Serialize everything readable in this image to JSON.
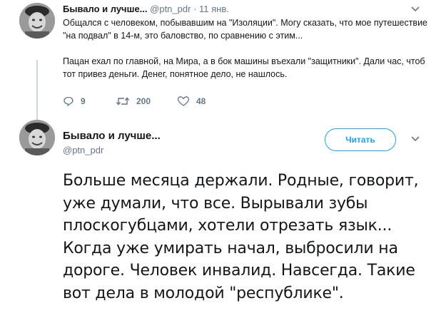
{
  "tweet1": {
    "name": "Бывало и лучше...",
    "handle": "@ptn_pdr",
    "separator": "·",
    "time": "11 янв.",
    "paragraph1": "Общался с человеком, побывавшим на \"Изоляции\". Могу сказать, что мое путешествие \"на подвал\" в 14-м, это баловство, по сравнению с этим...",
    "paragraph2": "Пацан ехал по главной, на Мира, а в бок машины въехали \"защитники\". Дали час, чтоб тот привез деньги. Денег, понятное дело, не нашлось.",
    "replies": "9",
    "retweets": "200",
    "likes": "48",
    "icons": [
      "reply-icon",
      "retweet-icon",
      "like-icon",
      "chevron-down-icon"
    ]
  },
  "tweet2": {
    "name": "Бывало и лучше...",
    "handle": "@ptn_pdr",
    "follow_label": "Читать",
    "text": "Больше месяца держали. Родные, говорит, уже думали, что все. Вырывали зубы плоскогубцами, хотели отрезать язык... Когда уже умирать начал, выбросили на дороге. Человек инвалид. Навсегда. Такие вот дела в молодой \"республике\"."
  },
  "colors": {
    "accent": "#1da1f2",
    "secondary_text": "#657786",
    "primary_text": "#14171a",
    "thread_line": "#ccd6dd"
  }
}
